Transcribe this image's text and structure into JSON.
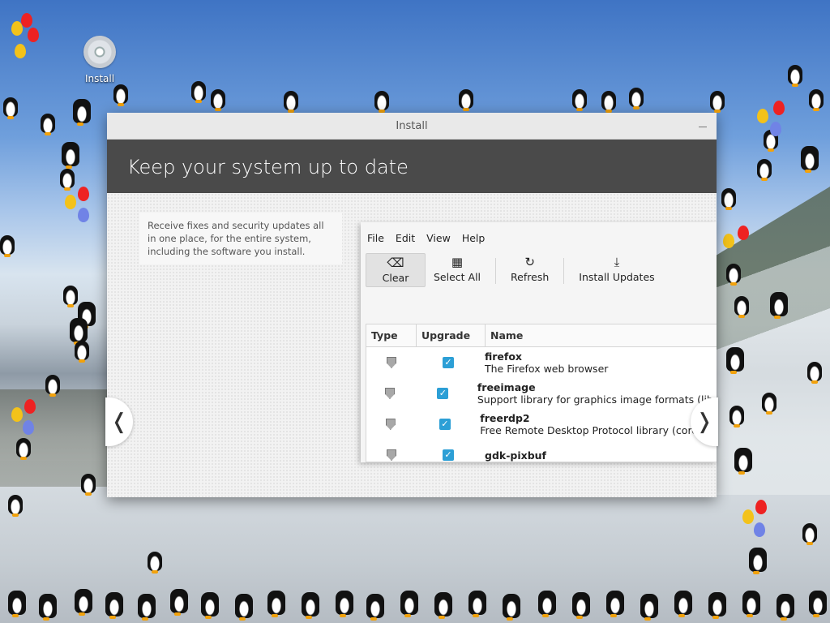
{
  "desktop": {
    "install_icon_label": "Install"
  },
  "window": {
    "title": "Install",
    "header": "Keep your system up to date",
    "description": "Receive fixes and security updates all in one place, for the entire system, including the software you install.",
    "nav_prev_icon": "chevron-left-icon",
    "nav_next_icon": "chevron-right-icon"
  },
  "update_manager": {
    "menu": [
      "File",
      "Edit",
      "View",
      "Help"
    ],
    "toolbar": [
      {
        "label": "Clear",
        "icon": "backspace-icon"
      },
      {
        "label": "Select All",
        "icon": "select-all-icon"
      },
      {
        "label": "Refresh",
        "icon": "refresh-icon"
      },
      {
        "label": "Install Updates",
        "icon": "download-icon"
      }
    ],
    "columns": [
      "Type",
      "Upgrade",
      "Name"
    ],
    "rows": [
      {
        "name": "firefox",
        "description": "The Firefox web browser"
      },
      {
        "name": "freeimage",
        "description": "Support library for graphics image formats (libr"
      },
      {
        "name": "freerdp2",
        "description": "Free Remote Desktop Protocol library (core libr"
      },
      {
        "name": "gdk-pixbuf",
        "description": ""
      }
    ]
  },
  "colors": {
    "header_bg": "#4a4a4a",
    "checkbox": "#2c9fd6"
  }
}
